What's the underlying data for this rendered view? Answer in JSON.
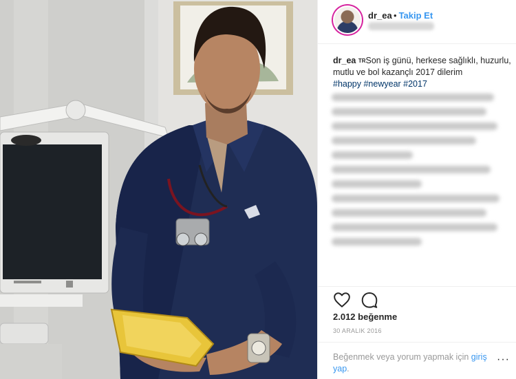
{
  "post": {
    "username": "dr_ea",
    "follow_separator": "•",
    "follow_label": "Takip Et",
    "caption": {
      "username": "dr_ea",
      "flag": "TR",
      "text": "Son iş günü, herkese sağlıklı, huzurlu, mutlu ve bol kazançlı 2017 dilerim",
      "hashtags": "#happy #newyear #2017"
    },
    "likes": "2.012 beğenme",
    "date": "30 ARALIK 2016",
    "login_prompt": {
      "before": "Beğenmek veya yorum yapmak için ",
      "link": "giriş yap",
      "after": "."
    },
    "more": "···"
  },
  "icons": {
    "like": "heart-outline-icon",
    "comment": "speech-bubble-outline-icon"
  },
  "colors": {
    "link": "#3897f0",
    "hashtag": "#003569",
    "text": "#262626",
    "muted": "#999999",
    "shirt": "#1f2d54",
    "clipboard": "#e8c53a"
  }
}
